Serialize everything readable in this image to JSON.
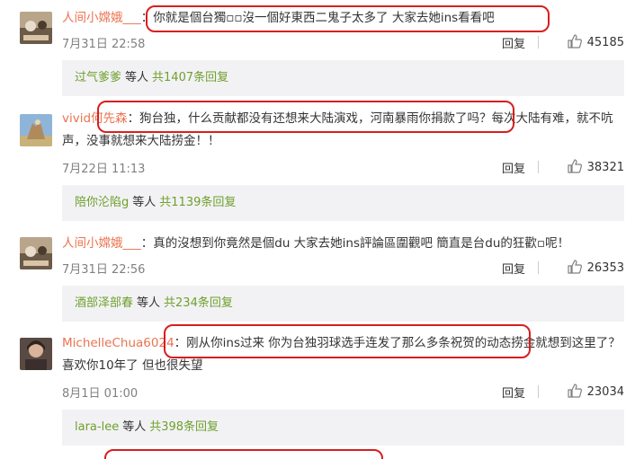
{
  "comments": [
    {
      "username": "人间小嫦娥___",
      "text": "：你就是個台獨▫▫沒一個好東西二鬼子太多了 大家去她ins看看吧",
      "time": "7月31日 22:58",
      "reply_label": "回复",
      "likes": "45185",
      "replies": {
        "name": "过气爹爹",
        "etc": "等人",
        "total": "共1407条回复"
      }
    },
    {
      "username": "vivid何先森",
      "text": "：狗台独，什么贡献都没有还想来大陆演戏，河南暴雨你捐款了吗？每次大陆有难，就不吭声，没事就想来大陆捞金！！",
      "time": "7月22日 11:13",
      "reply_label": "回复",
      "likes": "38321",
      "replies": {
        "name": "陪你沦陷g",
        "etc": "等人",
        "total": "共1139条回复"
      }
    },
    {
      "username": "人间小嫦娥___",
      "text": "：真的沒想到你竟然是個du 大家去她ins評論區圍觀吧 簡直是台du的狂歡▫呢！",
      "time": "7月31日 22:56",
      "reply_label": "回复",
      "likes": "26353",
      "replies": {
        "name": "酒部泽部春",
        "etc": "等人",
        "total": "共234条回复"
      }
    },
    {
      "username": "MichelleChua6024",
      "text": "：刚从你ins过来 你为台独羽球选手连发了那么多条祝贺的动态捞金就想到这里了？喜欢你10年了 但也很失望",
      "time": "8月1日 01:00",
      "reply_label": "回复",
      "likes": "23034",
      "replies": {
        "name": "lara-lee",
        "etc": "等人",
        "total": "共398条回复"
      }
    }
  ],
  "icons": {
    "like": "thumbs-up-icon"
  },
  "colors": {
    "username": "#eb7350",
    "subreply_name": "#6fa02b",
    "highlight_circle": "#d91e1e",
    "subreply_bg": "#f2f2f5"
  }
}
